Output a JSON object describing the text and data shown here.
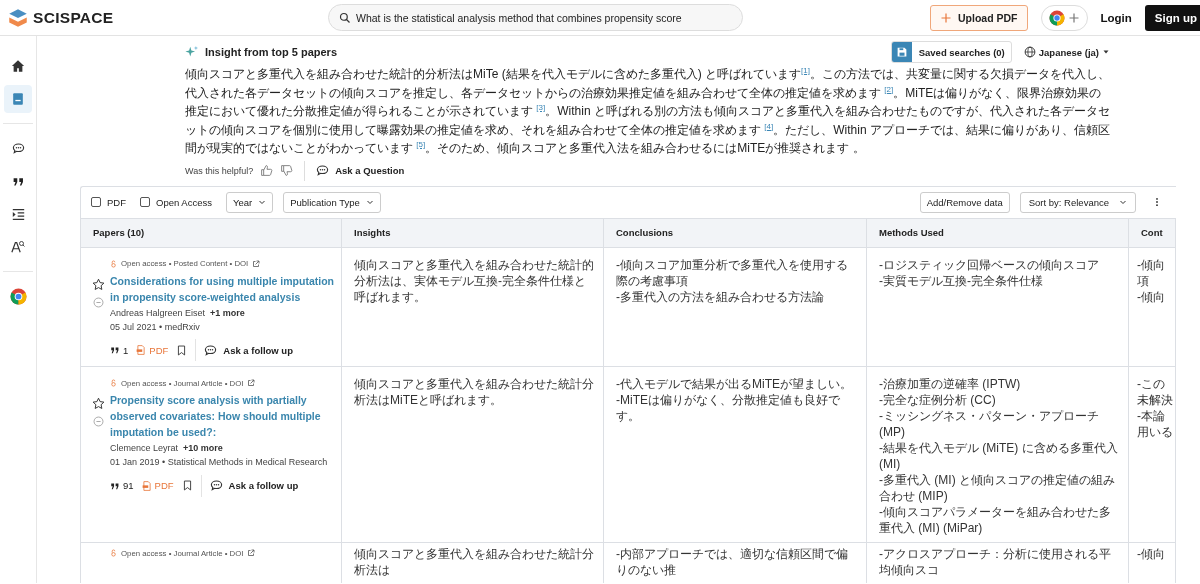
{
  "header": {
    "logo": "SCISPACE",
    "search": {
      "value": "What is the statistical analysis method that combines propensity score"
    },
    "upload_button": "Upload PDF",
    "login": "Login",
    "signup": "Sign up"
  },
  "sidebar": {
    "groups": [
      {
        "items": [
          {
            "kind": "home",
            "selected": false
          },
          {
            "kind": "library",
            "selected": true
          }
        ]
      },
      {
        "items": [
          {
            "kind": "chat",
            "selected": false
          },
          {
            "kind": "quote",
            "selected": false
          },
          {
            "kind": "outline",
            "selected": false
          },
          {
            "kind": "letter",
            "selected": false
          }
        ]
      },
      {
        "items": [
          {
            "kind": "chrome",
            "selected": false
          }
        ]
      }
    ]
  },
  "insight": {
    "title": "Insight from top 5 papers",
    "saved_searches": "Saved searches (0)",
    "language": "Japanese (ja)",
    "paragraph": "傾向スコアと多重代入を組み合わせた統計的分析法はMiTe (結果を代入モデルに含めた多重代入) と呼ばれています$^{[1]}$。この方法では、共変量に関する欠損データを代入し、代入された各データセットの傾向スコアを推定し、各データセットからの治療効果推定値を組み合わせて全体の推定値を求めます $^{[2]}$。MiTEは偏りがなく、限界治療効果の推定において優れた分散推定値が得られることが示されています $^{[3]}$。Within と呼ばれる別の方法も傾向スコアと多重代入を組み合わせたものですが、代入された各データセットの傾向スコアを個別に使用して曝露効果の推定値を求め、それを組み合わせて全体の推定値を求めます $^{[4]}$。ただし、Within アプローチでは、結果に偏りがあり、信頼区間が現実的ではないことがわかっています $^{[5]}$。そのため、傾向スコアと多重代入法を組み合わせるにはMiTEが推奨されます 。",
    "helpful_label": "Was this helpful?",
    "ask_button": "Ask a Question"
  },
  "table": {
    "filters": [
      {
        "kind": "checkbox",
        "label": "PDF",
        "checked": false
      },
      {
        "kind": "checkbox",
        "label": "Open Access",
        "checked": false
      },
      {
        "kind": "dropdown",
        "label": "Year"
      },
      {
        "kind": "dropdown",
        "label": "Publication Type"
      }
    ],
    "add_remove": "Add/Remove data",
    "sort": "Sort by: Relevance",
    "columns": [
      "Papers (10)",
      "Insights",
      "Conclusions",
      "Methods Used",
      "Cont"
    ],
    "rows": [
      {
        "meta": "Open access • Posted Content • DOI",
        "title": "Considerations for using multiple imputation in propensity score-weighted analysis",
        "author": "Andreas Halgreen Eiset",
        "more": "+1 more",
        "date": "05 Jul 2021 • medRxiv",
        "citations": "1",
        "pdf": "PDF",
        "followup": "Ask a follow up",
        "insights": "傾向スコアと多重代入を組み合わせた統計的分析法は、実体モデル互換-完全条件仕様と呼ばれます。",
        "conclusions": [
          "-傾向スコア加重分析で多重代入を使用する際の考慮事項",
          "-多重代入の方法を組み合わせる方法論"
        ],
        "methods": [
          "-ロジスティック回帰ベースの傾向スコア",
          "-実質モデル互換-完全条件仕様"
        ],
        "column_5": [
          "-傾向",
          "項",
          "-傾向"
        ]
      },
      {
        "meta": "Open access • Journal Article • DOI",
        "title": "Propensity score analysis with partially observed covariates: How should multiple imputation be used?:",
        "author": "Clemence Leyrat",
        "more": "+10 more",
        "date": "01 Jan 2019 • Statistical Methods in Medical Research",
        "citations": "91",
        "pdf": "PDF",
        "followup": "Ask a follow up",
        "insights": "傾向スコアと多重代入を組み合わせた統計分析法はMiTEと呼ばれます。",
        "conclusions": [
          "-代入モデルで結果が出るMiTEが望ましい。",
          "-MiTEは偏りがなく、分散推定値も良好です。"
        ],
        "methods": [
          "-治療加重の逆確率 (IPTW)",
          "-完全な症例分析 (CC)",
          "-ミッシングネス・パターン・アプローチ (MP)",
          "-結果を代入モデル (MiTE) に含める多重代入 (MI)",
          "-多重代入 (MI) と傾向スコアの推定値の組み合わせ (MIP)",
          "-傾向スコアパラメーターを組み合わせた多重代入 (MI) (MiPar)"
        ],
        "column_5": [
          "-この",
          "未解決",
          "-本論",
          "用いる"
        ]
      },
      {
        "meta": "Open access • Journal Article • DOI",
        "insights": "傾向スコアと多重代入を組み合わせた統計分析法は",
        "conclusions": [
          "-内部アプローチでは、適切な信頼区間で偏りのない推"
        ],
        "methods": [
          "-アクロスアプローチ：分析に使用される平均傾向スコ"
        ],
        "column_5": [
          "-傾向"
        ]
      }
    ]
  }
}
